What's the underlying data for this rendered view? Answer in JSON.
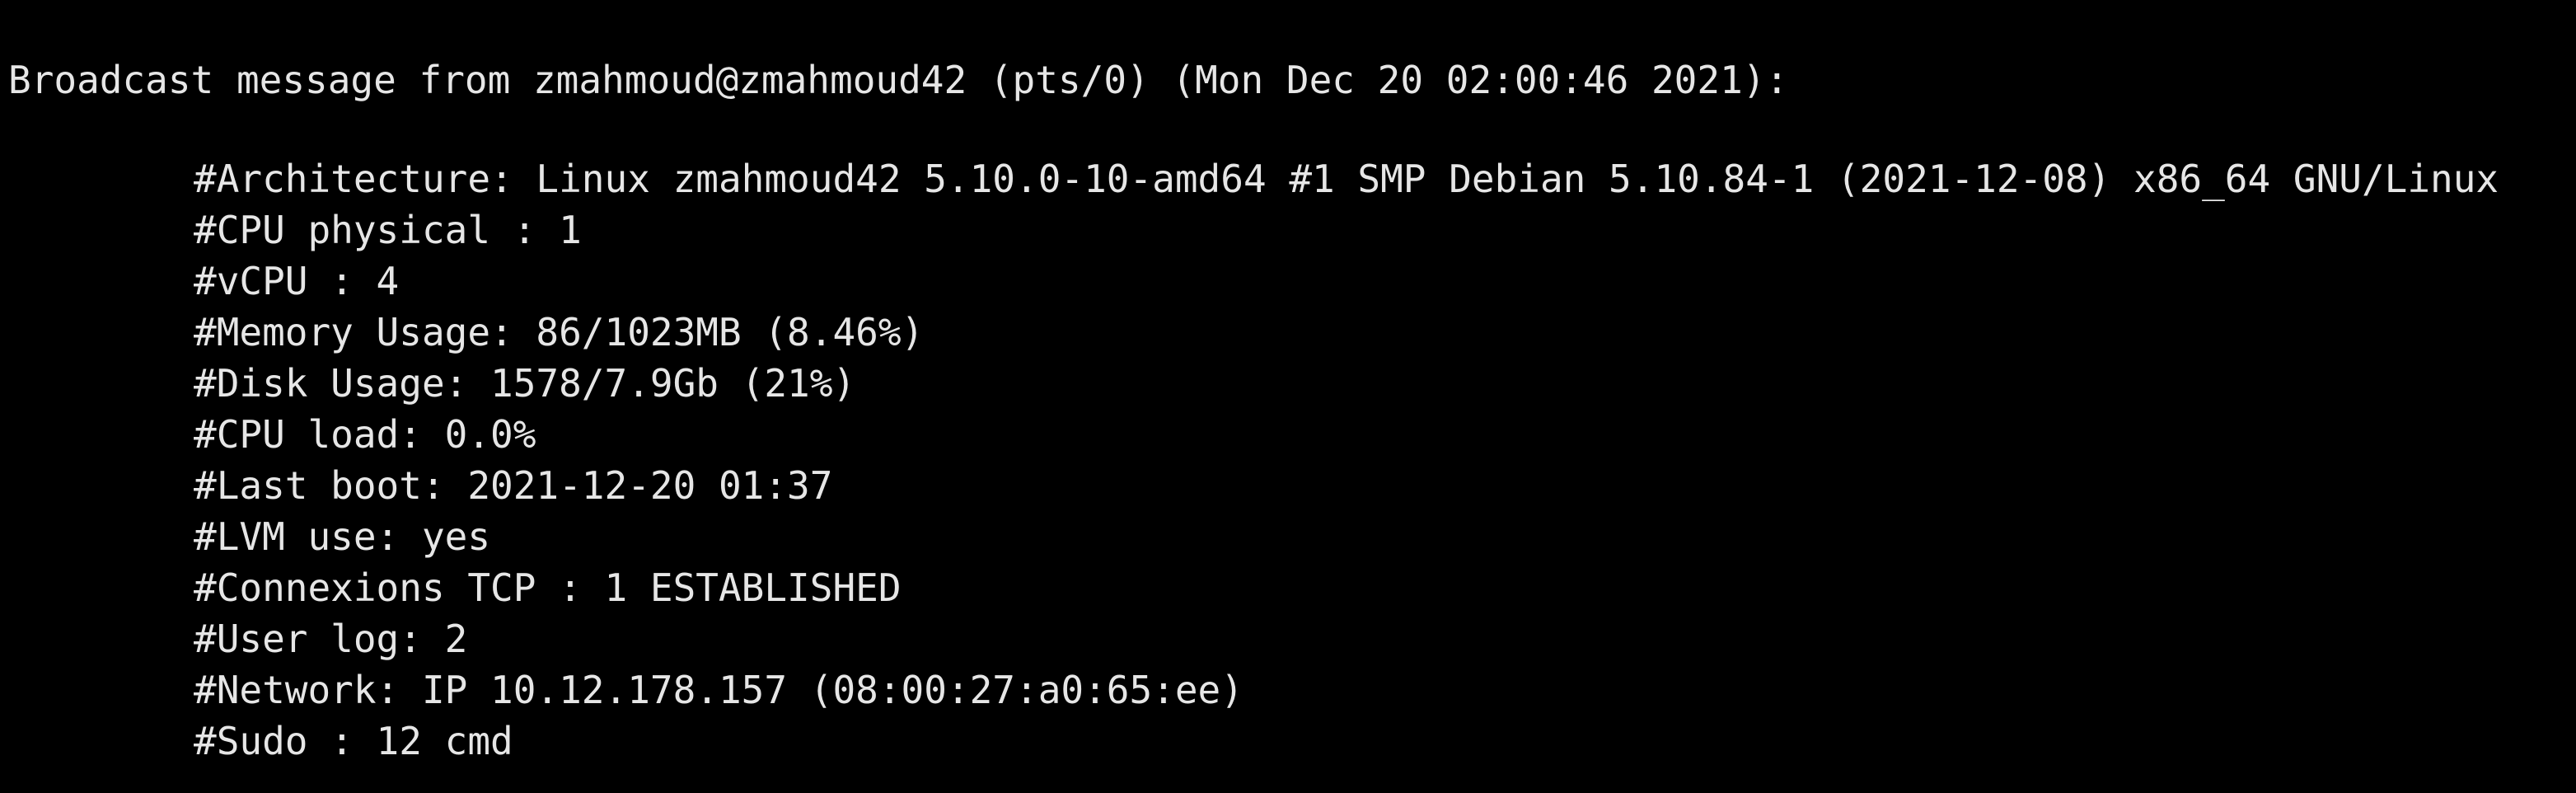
{
  "terminal": {
    "broadcast_header": "Broadcast message from zmahmoud@zmahmoud42 (pts/0) (Mon Dec 20 02:00:46 2021):",
    "lines": [
      "#Architecture: Linux zmahmoud42 5.10.0-10-amd64 #1 SMP Debian 5.10.84-1 (2021-12-08) x86_64 GNU/Linux",
      "#CPU physical : 1",
      "#vCPU : 4",
      "#Memory Usage: 86/1023MB (8.46%)",
      "#Disk Usage: 1578/7.9Gb (21%)",
      "#CPU load: 0.0%",
      "#Last boot: 2021-12-20 01:37",
      "#LVM use: yes",
      "#Connexions TCP : 1 ESTABLISHED",
      "#User log: 2",
      "#Network: IP 10.12.178.157 (08:00:27:a0:65:ee)",
      "#Sudo : 12 cmd"
    ]
  },
  "colors": {
    "background": "#000000",
    "text": "#e6e6e6"
  }
}
